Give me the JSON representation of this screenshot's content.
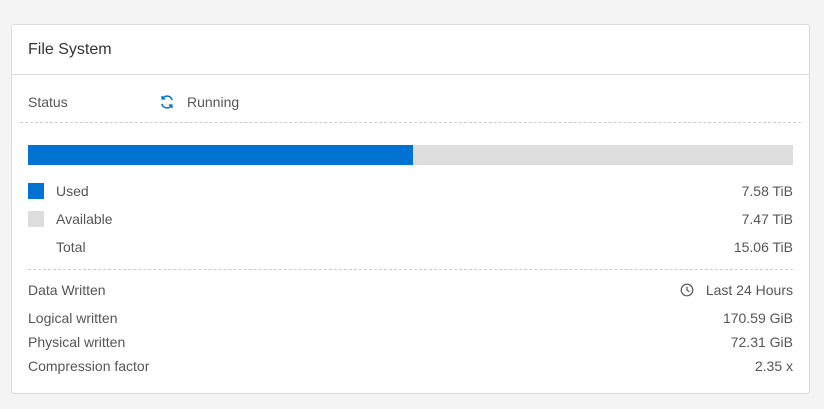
{
  "card": {
    "title": "File System"
  },
  "status": {
    "label": "Status",
    "value": "Running",
    "icon": "refresh-icon"
  },
  "usage": {
    "used_fraction": 0.503,
    "used_color": "#0072d1",
    "available_color": "#dddddd",
    "used": {
      "label": "Used",
      "value": "7.58 TiB"
    },
    "available": {
      "label": "Available",
      "value": "7.47 TiB"
    },
    "total": {
      "label": "Total",
      "value": "15.06 TiB"
    }
  },
  "data_written": {
    "label": "Data Written",
    "period": "Last 24 Hours",
    "period_icon": "clock-icon",
    "logical": {
      "label": "Logical written",
      "value": "170.59 GiB"
    },
    "physical": {
      "label": "Physical written",
      "value": "72.31 GiB"
    },
    "compression": {
      "label": "Compression factor",
      "value": "2.35 x"
    }
  }
}
